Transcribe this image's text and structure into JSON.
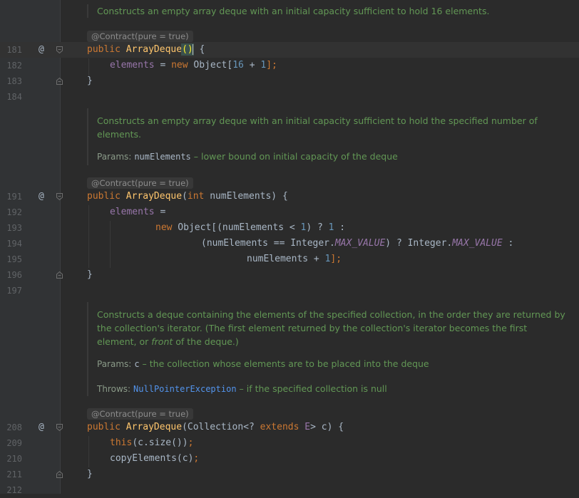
{
  "doc1": {
    "text": "Constructs an empty array deque with an initial capacity sufficient to hold 16 elements."
  },
  "contract1": "@Contract(pure = true)",
  "l181": {
    "num": "181",
    "ann": "@",
    "kw": "public",
    "fn": "ArrayDeque",
    "open": "(",
    "close": ")",
    "rest": " {"
  },
  "l182": {
    "num": "182",
    "field": "elements",
    "eq": " = ",
    "kw": "new",
    "obj": " Object[",
    "n1": "16",
    "plus": " + ",
    "n2": "1",
    "end": "];"
  },
  "l183": {
    "num": "183",
    "text": "}"
  },
  "l184": {
    "num": "184"
  },
  "doc2": {
    "text": "Constructs an empty array deque with an initial capacity sufficient to hold the specified number of elements.",
    "params_label": "Params:",
    "param_name": "numElements",
    "param_desc": "– lower bound on initial capacity of the deque"
  },
  "contract2": "@Contract(pure = true)",
  "l191": {
    "num": "191",
    "ann": "@",
    "kw": "public",
    "fn": "ArrayDeque",
    "p1": "(",
    "kw2": "int",
    "rest": " numElements) {"
  },
  "l192": {
    "num": "192",
    "field": "elements",
    "eq": " ="
  },
  "l193": {
    "num": "193",
    "kw": "new",
    "a": " Object[(numElements < ",
    "n1": "1",
    "b": ") ? ",
    "n2": "1",
    "c": " :"
  },
  "l194": {
    "num": "194",
    "a": "(numElements == Integer.",
    "const1": "MAX_VALUE",
    "b": ") ? Integer.",
    "const2": "MAX_VALUE",
    "c": " :"
  },
  "l195": {
    "num": "195",
    "a": "numElements + ",
    "n1": "1",
    "end": "];"
  },
  "l196": {
    "num": "196",
    "text": "}"
  },
  "l197": {
    "num": "197"
  },
  "doc3": {
    "t1": "Constructs a deque containing the elements of the specified collection, in the order they are returned by the collection's iterator. (The first element returned by the collection's iterator becomes the first element, or ",
    "em": "front",
    "t2": " of the deque.)",
    "params_label": "Params:",
    "param_name": "c",
    "param_desc": "– the collection whose elements are to be placed into the deque",
    "throws_label": "Throws:",
    "throws_name": "NullPointerException",
    "throws_desc": "– if the specified collection is null"
  },
  "contract3": "@Contract(pure = true)",
  "l208": {
    "num": "208",
    "ann": "@",
    "kw": "public",
    "fn": "ArrayDeque",
    "a": "(Collection<? ",
    "kw2": "extends",
    "b": " ",
    "tp": "E",
    "c": "> c) {"
  },
  "l209": {
    "num": "209",
    "kw": "this",
    "a": "(c.size())",
    "end": ";"
  },
  "l210": {
    "num": "210",
    "a": "copyElements(c)",
    "end": ";"
  },
  "l211": {
    "num": "211",
    "text": "}"
  },
  "l212": {
    "num": "212"
  }
}
